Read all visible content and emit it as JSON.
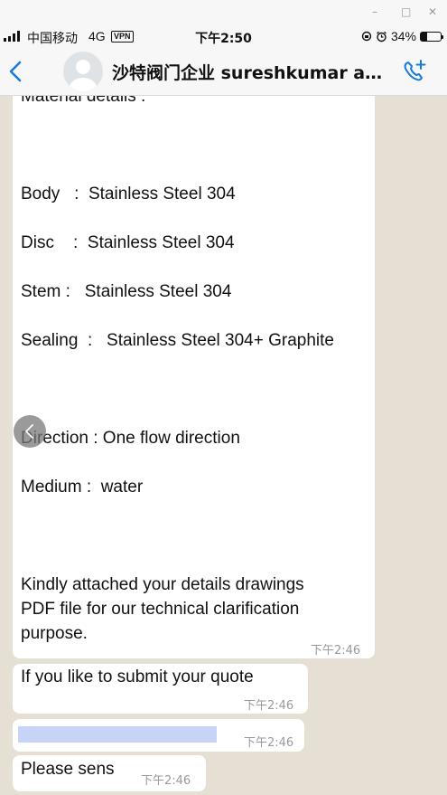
{
  "window": {
    "controls": [
      "–",
      "□",
      "✕"
    ]
  },
  "status_bar": {
    "carrier": "中国移动",
    "network": "4G",
    "vpn": "VPN",
    "time": "下午2:50",
    "battery_percent": "34%",
    "battery_level": 0.34,
    "icons": [
      "signal-icon",
      "rotation-lock-icon",
      "alarm-icon",
      "battery-icon"
    ]
  },
  "header": {
    "title": "沙特阀门企业 sureshkumar aru...",
    "icons": [
      "back-chevron-icon",
      "avatar-icon",
      "add-call-icon"
    ]
  },
  "messages": [
    {
      "lines": [
        "Material details :",
        "Body   :  Stainless Steel 304",
        "Disc    :  Stainless Steel 304",
        "Stem :   Stainless Steel 304",
        "Sealing  :   Stainless Steel 304+ Graphite",
        "Direction : One flow direction",
        "Medium :  water",
        "Kindly attached your details drawings",
        "PDF file for our technical clarification",
        "purpose."
      ],
      "time": "下午2:46"
    },
    {
      "text": "If you like to submit your quote",
      "time": "下午2:46"
    },
    {
      "text": "",
      "time": "下午2:46",
      "redacted": true
    },
    {
      "text": "Please sens",
      "time": "下午2:46"
    }
  ],
  "colors": {
    "accent": "#1a7ad9",
    "chat_bg": "#e6dfd4",
    "bubble": "#ffffff",
    "timestamp": "#9a9a9a",
    "redaction": "#c7d4f7"
  }
}
